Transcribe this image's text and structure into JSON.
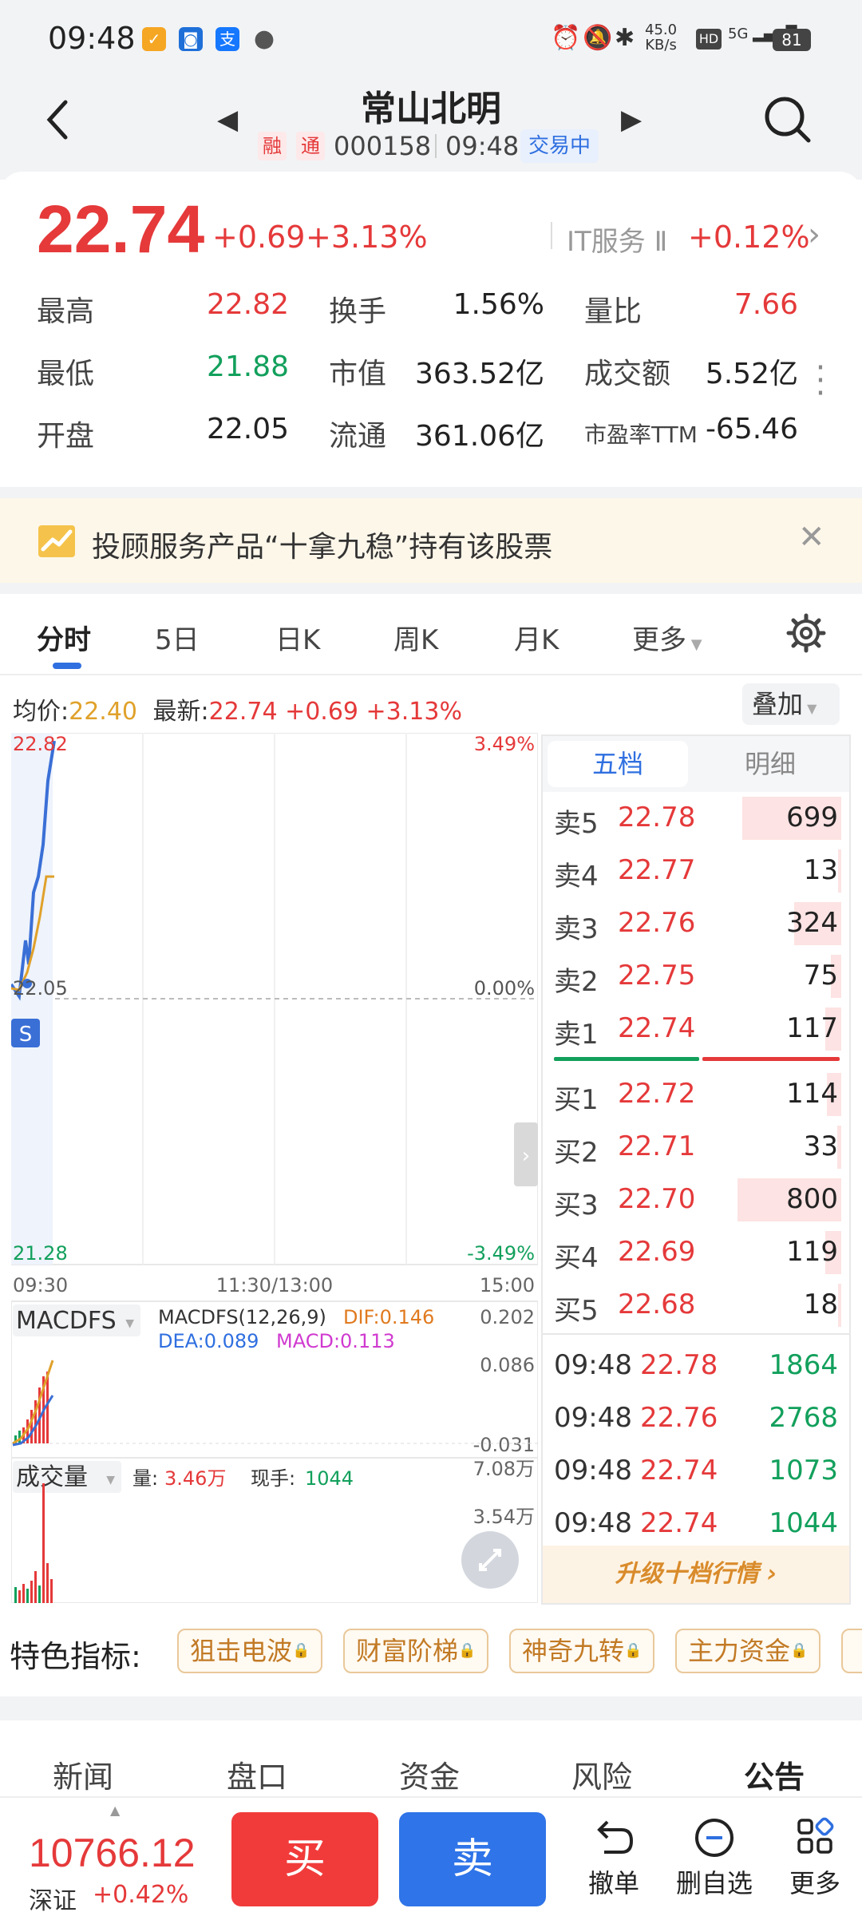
{
  "status_bar": {
    "time": "09:48",
    "net_speed": "45.0\nKB/s",
    "net_speed_top": "45.0",
    "net_speed_bottom": "KB/s",
    "hd": "HD",
    "signal": "5G",
    "battery": "81"
  },
  "header": {
    "stock_name": "常山北明",
    "tag_rong": "融",
    "tag_tong": "通",
    "code": "000158",
    "time": "09:48",
    "trading_status": "交易中"
  },
  "quote": {
    "last_price": "22.74",
    "change_abs": "+0.69",
    "change_pct": "+3.13%",
    "sector_name": "IT服务 Ⅱ",
    "sector_pct": "+0.12%",
    "stats": [
      {
        "label": "最高",
        "value": "22.82",
        "color": "#e5393a"
      },
      {
        "label": "换手",
        "value": "1.56%",
        "color": "#222222"
      },
      {
        "label": "量比",
        "value": "7.66",
        "color": "#e5393a"
      },
      {
        "label": "最低",
        "value": "21.88",
        "color": "#12a05c"
      },
      {
        "label": "市值",
        "value": "363.52亿",
        "color": "#222222"
      },
      {
        "label": "成交额",
        "value": "5.52亿",
        "color": "#222222"
      },
      {
        "label": "开盘",
        "value": "22.05",
        "color": "#222222"
      },
      {
        "label": "流通",
        "value": "361.06亿",
        "color": "#222222"
      },
      {
        "label": "市盈率TTM",
        "value": "-65.46",
        "color": "#222222"
      }
    ]
  },
  "promo": {
    "text": "投顾服务产品“十拿九稳”持有该股票"
  },
  "chart_tabs": [
    "分时",
    "5日",
    "日K",
    "周K",
    "月K",
    "更多"
  ],
  "chart_info": {
    "avg_label": "均价:",
    "avg_value": "22.40",
    "latest_label": "最新:",
    "latest_value": "22.74 +0.69 +3.13%",
    "overlay": "叠加"
  },
  "chart": {
    "y_top": "22.82",
    "y_mid": "22.05",
    "y_bottom": "21.28",
    "pct_top": "3.49%",
    "pct_mid": "0.00%",
    "pct_bottom": "-3.49%",
    "x_start": "09:30",
    "x_mid": "11:30/13:00",
    "x_end": "15:00",
    "marker": "S",
    "macd_name": "MACDFS",
    "macd_params": "MACDFS(12,26,9)",
    "dif": "DIF:0.146",
    "dea": "DEA:0.089",
    "macd": "MACD:0.113",
    "macd_top": "0.202",
    "macd_mid": "0.086",
    "macd_bottom": "-0.031",
    "vol_name": "成交量",
    "vol_label": "量:",
    "vol_value": "3.46万",
    "hand_label": "现手:",
    "hand_value": "1044",
    "vol_top": "7.08万",
    "vol_mid": "3.54万"
  },
  "orderbook": {
    "tab_five": "五档",
    "tab_detail": "明细",
    "asks": [
      {
        "label": "卖5",
        "price": "22.78",
        "vol": "699",
        "bar": 0.95
      },
      {
        "label": "卖4",
        "price": "22.77",
        "vol": "13",
        "bar": 0.02
      },
      {
        "label": "卖3",
        "price": "22.76",
        "vol": "324",
        "bar": 0.45
      },
      {
        "label": "卖2",
        "price": "22.75",
        "vol": "75",
        "bar": 0.1
      },
      {
        "label": "卖1",
        "price": "22.74",
        "vol": "117",
        "bar": 0.15
      }
    ],
    "bids": [
      {
        "label": "买1",
        "price": "22.72",
        "vol": "114",
        "bar": 0.14
      },
      {
        "label": "买2",
        "price": "22.71",
        "vol": "33",
        "bar": 0.04
      },
      {
        "label": "买3",
        "price": "22.70",
        "vol": "800",
        "bar": 1.0
      },
      {
        "label": "买4",
        "price": "22.69",
        "vol": "119",
        "bar": 0.15
      },
      {
        "label": "买5",
        "price": "22.68",
        "vol": "18",
        "bar": 0.02
      }
    ],
    "ticks": [
      {
        "time": "09:48",
        "price": "22.78",
        "vol": "1864"
      },
      {
        "time": "09:48",
        "price": "22.76",
        "vol": "2768"
      },
      {
        "time": "09:48",
        "price": "22.74",
        "vol": "1073"
      },
      {
        "time": "09:48",
        "price": "22.74",
        "vol": "1044"
      }
    ],
    "upgrade": "升级十档行情 ›"
  },
  "special": {
    "label": "特色指标:",
    "chips": [
      "狙击电波",
      "财富阶梯",
      "神奇九转",
      "主力资金"
    ]
  },
  "bottom_tabs": [
    "新闻",
    "盘口",
    "资金",
    "风险",
    "公告"
  ],
  "bottom_bar": {
    "index_value": "10766.12",
    "index_name": "深证",
    "index_pct": "+0.42%",
    "buy": "买",
    "sell": "卖",
    "cancel": "撤单",
    "remove_fav": "删自选",
    "more": "更多"
  },
  "colors": {
    "up": "#e5393a",
    "down": "#12a05c",
    "accent": "#2f6fe0"
  }
}
